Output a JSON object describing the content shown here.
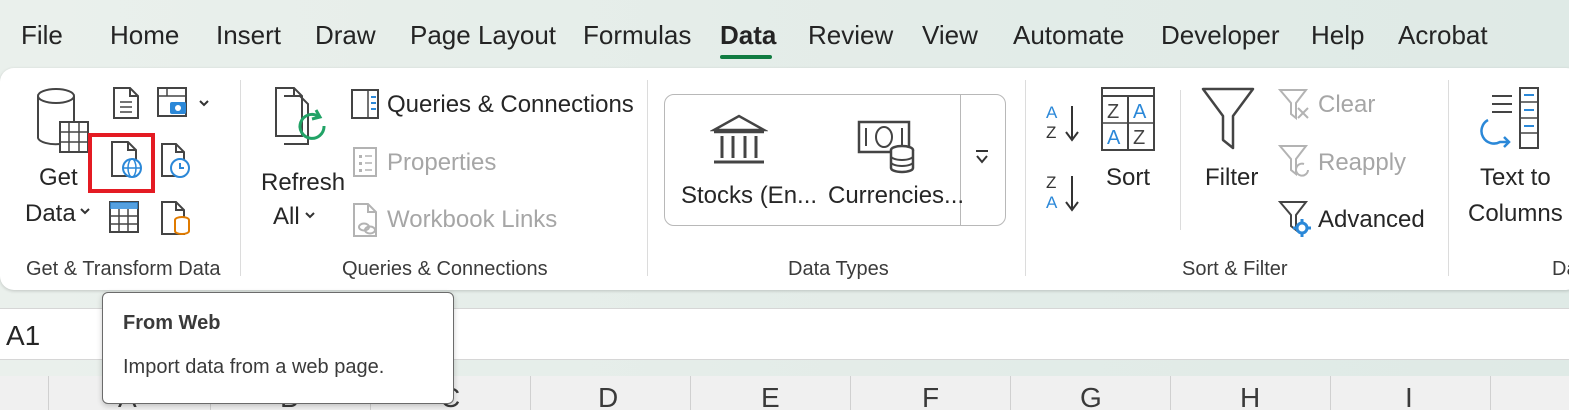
{
  "tabs": [
    "File",
    "Home",
    "Insert",
    "Draw",
    "Page Layout",
    "Formulas",
    "Data",
    "Review",
    "View",
    "Automate",
    "Developer",
    "Help",
    "Acrobat"
  ],
  "active_tab": "Data",
  "groups": {
    "get_transform": {
      "label": "Get & Transform Data",
      "get_data": [
        "Get",
        "Data"
      ]
    },
    "queries": {
      "label": "Queries & Connections",
      "refresh": [
        "Refresh",
        "All"
      ],
      "queries_connections": "Queries & Connections",
      "properties": "Properties",
      "workbook_links": "Workbook Links"
    },
    "data_types": {
      "label": "Data Types",
      "stocks": "Stocks (En...",
      "currencies": "Currencies..."
    },
    "sort_filter": {
      "label": "Sort & Filter",
      "sort": "Sort",
      "filter": "Filter",
      "clear": "Clear",
      "reapply": "Reapply",
      "advanced": "Advanced"
    },
    "data_tools": {
      "text_to_columns": [
        "Text to",
        "Columns"
      ],
      "label_partial": "Da"
    }
  },
  "name_box": "A1",
  "columns": [
    "A",
    "B",
    "C",
    "D",
    "E",
    "F",
    "G",
    "H",
    "I"
  ],
  "tooltip": {
    "title": "From Web",
    "description": "Import data from a web page."
  },
  "colors": {
    "accent": "#107c41",
    "highlight": "#e41b23",
    "icon_blue": "#2b88d8",
    "icon_green": "#21a366"
  }
}
